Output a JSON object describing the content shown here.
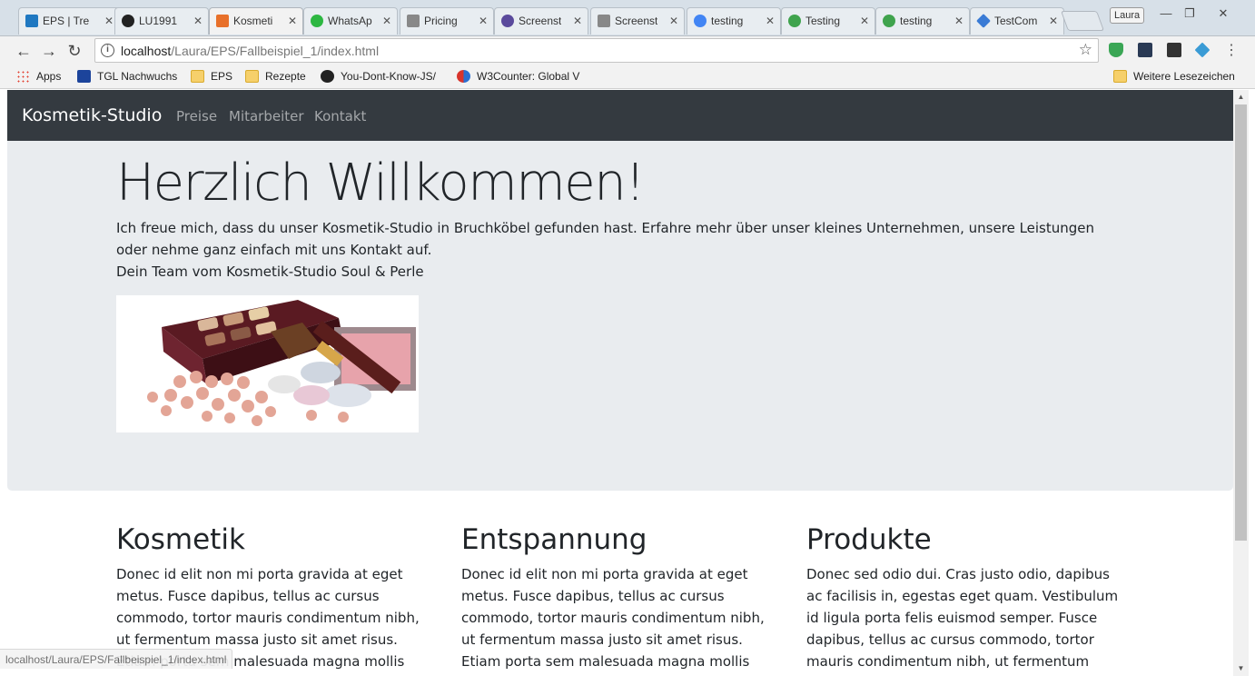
{
  "browser": {
    "tabs": [
      {
        "title": "EPS | Tre",
        "icon_color": "#1f78c1"
      },
      {
        "title": "LU1991",
        "icon_color": "#222222"
      },
      {
        "title": "Kosmeti",
        "icon_color": "#e8702a"
      },
      {
        "title": "WhatsAp",
        "icon_color": "#2cb742"
      },
      {
        "title": "Pricing",
        "icon_color": "#888888"
      },
      {
        "title": "Screenst",
        "icon_color": "#5a4a9c"
      },
      {
        "title": "Screenst",
        "icon_color": "#888888"
      },
      {
        "title": "testing",
        "icon_color": "#4285f4"
      },
      {
        "title": "Testing",
        "icon_color": "#3fa34d"
      },
      {
        "title": "testing",
        "icon_color": "#3fa34d"
      },
      {
        "title": "TestCom",
        "icon_color": "#3a7bd5"
      }
    ],
    "tab_close": "✕",
    "profile_name": "Laura",
    "window_controls": {
      "minimize": "—",
      "restore": "❐",
      "close": "✕"
    },
    "address": {
      "host": "localhost",
      "path": "/Laura/EPS/Fallbeispiel_1/index.html",
      "info_icon": "i",
      "star": "☆"
    },
    "nav": {
      "back": "←",
      "forward": "→",
      "reload": "↻"
    },
    "menu": "⋮",
    "extensions": [
      {
        "name": "shield-extension-icon",
        "color": "#3aa655"
      },
      {
        "name": "u-extension-icon",
        "color": "#2a3a55"
      },
      {
        "name": "selenium-extension-icon",
        "color": "#333333"
      },
      {
        "name": "diamond-extension-icon",
        "color": "#3a9bd5"
      }
    ],
    "bookmarks": [
      {
        "label": "Apps",
        "kind": "apps"
      },
      {
        "label": "TGL Nachwuchs",
        "kind": "gmx"
      },
      {
        "label": "EPS",
        "kind": "folder"
      },
      {
        "label": "Rezepte",
        "kind": "folder"
      },
      {
        "label": "You-Dont-Know-JS/",
        "kind": "github"
      },
      {
        "label": "W3Counter: Global V",
        "kind": "w3"
      }
    ],
    "other_bookmarks": "Weitere Lesezeichen",
    "status_url": "localhost/Laura/EPS/Fallbeispiel_1/index.html"
  },
  "site": {
    "brand": "Kosmetik-Studio",
    "links": [
      "Preise",
      "Mitarbeiter",
      "Kontakt"
    ],
    "hero": {
      "title": "Herzlich Willkommen!",
      "text": "Ich freue mich, dass du unser Kosmetik-Studio in Bruchköbel gefunden hast. Erfahre mehr über unser kleines Unternehmen, unsere Leistungen oder nehme ganz einfach mit uns Kontakt auf.",
      "signature": "Dein Team vom Kosmetik-Studio Soul & Perle"
    },
    "columns": [
      {
        "heading": "Kosmetik",
        "text": "Donec id elit non mi porta gravida at eget metus. Fusce dapibus, tellus ac cursus commodo, tortor mauris condimentum nibh, ut fermentum massa justo sit amet risus. Etiam porta sem malesuada magna mollis euismod. Donec sed odio dui."
      },
      {
        "heading": "Entspannung",
        "text": "Donec id elit non mi porta gravida at eget metus. Fusce dapibus, tellus ac cursus commodo, tortor mauris condimentum nibh, ut fermentum massa justo sit amet risus. Etiam porta sem malesuada magna mollis euismod. Donec sed odio dui."
      },
      {
        "heading": "Produkte",
        "text": "Donec sed odio dui. Cras justo odio, dapibus ac facilisis in, egestas eget quam. Vestibulum id ligula porta felis euismod semper. Fusce dapibus, tellus ac cursus commodo, tortor mauris condimentum nibh, ut fermentum massa justo sit"
      }
    ]
  }
}
